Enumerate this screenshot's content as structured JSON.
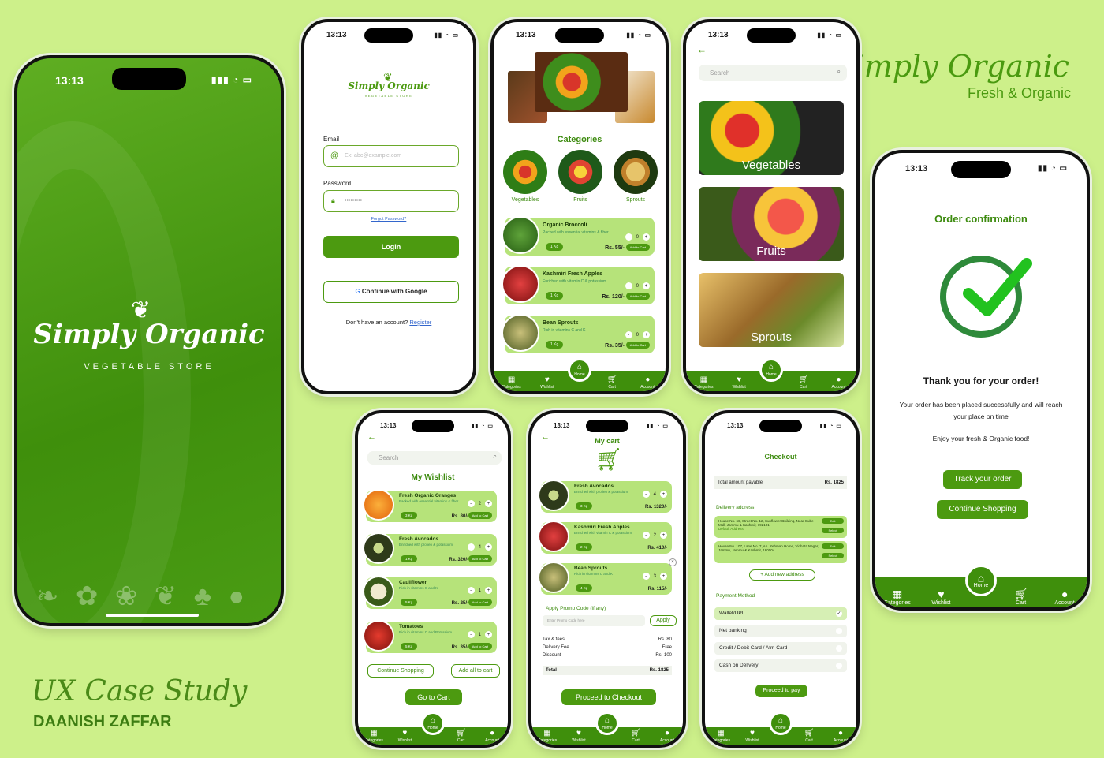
{
  "brand": {
    "title": "Simply Organic",
    "subtitle": "Fresh & Organic"
  },
  "case_study": {
    "title": "UX Case Study",
    "author": "DAANISH ZAFFAR"
  },
  "status": {
    "time": "13:13"
  },
  "splash": {
    "logo_text": "Simply Organic",
    "logo_sub": "VEGETABLE STORE"
  },
  "login": {
    "logo": "Simply Organic",
    "logo_sub": "VEGETABLE STORE",
    "email_label": "Email",
    "email_placeholder": "Ex: abc@example.com",
    "password_label": "Password",
    "password_value": "•••••••••",
    "forgot": "Forgot Password?",
    "login_btn": "Login",
    "google_btn": "Continue with Google",
    "no_account": "Don't have an account?",
    "register": "Register"
  },
  "nav": {
    "categories": "Categories",
    "wishlist": "Wishlist",
    "home": "Home",
    "cart": "Cart",
    "account": "Account"
  },
  "home": {
    "categories_title": "Categories",
    "cats": [
      "Vegetables",
      "Fruits",
      "Sprouts"
    ],
    "products": [
      {
        "name": "Organic Broccoli",
        "desc": "Packed with essential vitamins & fiber",
        "qty": "1 Kg",
        "count": "0",
        "price": "Rs. 55/-",
        "add": "Add to Cart"
      },
      {
        "name": "Kashmiri Fresh Apples",
        "desc": "Enriched with vitamin C & potassium",
        "qty": "1 Kg",
        "count": "0",
        "price": "Rs. 120/-",
        "add": "Add to Cart"
      },
      {
        "name": "Bean Sprouts",
        "desc": "Rich in vitamins C and K",
        "qty": "1 Kg",
        "count": "0",
        "price": "Rs. 35/-",
        "add": "Add to Cart"
      }
    ]
  },
  "cat_screen": {
    "search": "Search",
    "cards": [
      "Vegetables",
      "Fruits",
      "Sprouts"
    ]
  },
  "confirm": {
    "title": "Order confirmation",
    "thanks": "Thank you for your order!",
    "msg": "Your order has been placed successfully and will reach your place on time",
    "enjoy": "Enjoy your fresh & Organic food!",
    "track": "Track your order",
    "continue": "Continue Shopping"
  },
  "wishlist": {
    "search": "Search",
    "title": "My Wishlist",
    "items": [
      {
        "name": "Fresh Organic Oranges",
        "desc": "Packed with essential vitamins & fiber",
        "qty": "3 Kg",
        "count": "2",
        "price": "Rs. 80/-",
        "add": "Add to Cart"
      },
      {
        "name": "Fresh Avocados",
        "desc": "Enriched with protien & potassium",
        "qty": "1 Kg",
        "count": "4",
        "price": "Rs. 320/-",
        "add": "Add to Cart"
      },
      {
        "name": "Cauliflower",
        "desc": "Rich in vitamins C and K",
        "qty": "5 Kg",
        "count": "1",
        "price": "Rs. 25/-",
        "add": "Add to Cart"
      },
      {
        "name": "Tomatoes",
        "desc": "Rich in vitamins C and Potassium",
        "qty": "5 Kg",
        "count": "1",
        "price": "Rs. 35/-",
        "add": "Add to Cart"
      }
    ],
    "continue": "Continue Shopping",
    "add_all": "Add all to cart",
    "go_cart": "Go to Cart"
  },
  "cart": {
    "title": "My cart",
    "items": [
      {
        "name": "Fresh Avocados",
        "desc": "Enriched with protien & potassium",
        "qty": "3 Kg",
        "count": "4",
        "price": "Rs. 1320/-"
      },
      {
        "name": "Kashmiri Fresh Apples",
        "desc": "Enriched with vitamin C & potassium",
        "qty": "2 Kg",
        "count": "2",
        "price": "Rs. 410/-"
      },
      {
        "name": "Bean Sprouts",
        "desc": "Rich in vitamins C and K",
        "qty": "4 Kg",
        "count": "3",
        "price": "Rs. 115/-"
      }
    ],
    "promo_label": "Apply Promo Code (if any)",
    "promo_placeholder": "Enter Promo Code here",
    "apply": "Apply",
    "lines": [
      {
        "k": "Tax & fees",
        "v": "Rs. 80"
      },
      {
        "k": "Delivery Fee",
        "v": "Free"
      },
      {
        "k": "Discount",
        "v": "Rs. 100"
      }
    ],
    "total_k": "Total",
    "total_v": "Rs. 1825",
    "checkout_btn": "Proceed to Checkout"
  },
  "checkout": {
    "title": "Checkout",
    "payable_k": "Total amount payable",
    "payable_v": "Rs. 1825",
    "addr_title": "Delivery address",
    "addresses": [
      {
        "text": "House No. 66, Street No. 12, Sunflower Building, Near Cube Mall, Jammu & Kashmir, 192101",
        "tag": "Default Address"
      },
      {
        "text": "House No. 107, Lane No. 7, Ab. Rehman Home, Vidhata Nagar, Jammu, Jammu & Kashmir, 180004",
        "tag": ""
      }
    ],
    "edit": "Edit",
    "select": "Select",
    "add_addr": "+ Add new address",
    "pay_title": "Payment Method",
    "methods": [
      "Wallet/UPI",
      "Net banking",
      "Credit / Debit Card / Atm Card",
      "Cash on Delivery"
    ],
    "pay_btn": "Proceed to pay"
  }
}
